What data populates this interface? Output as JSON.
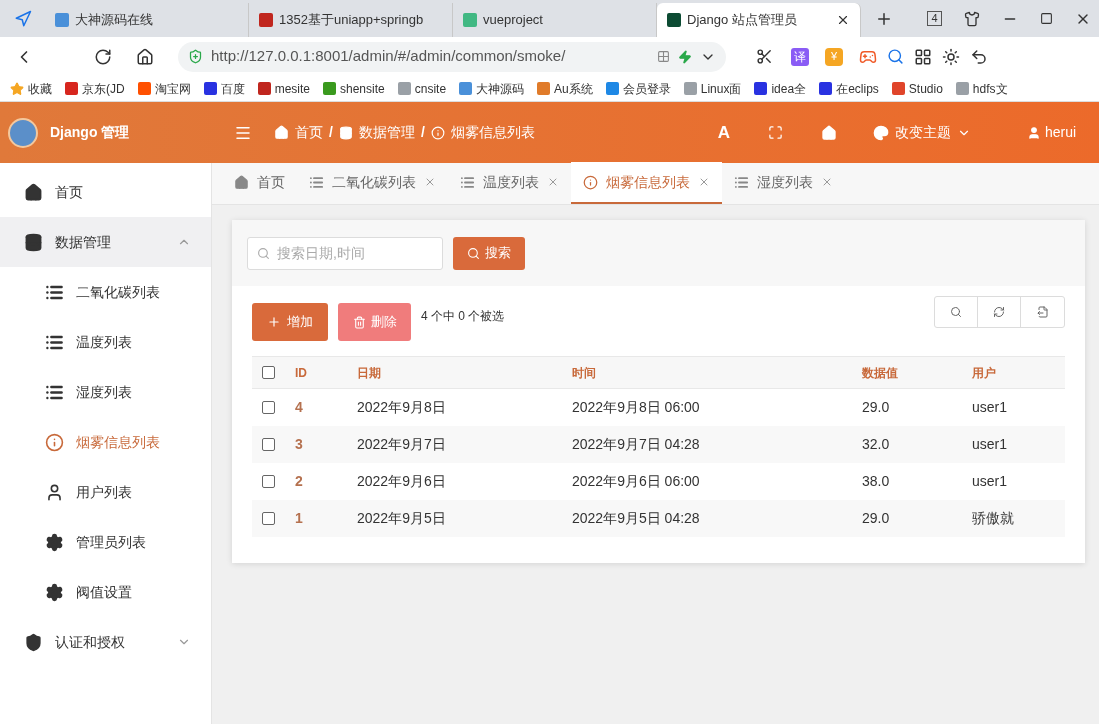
{
  "browser": {
    "tabs": [
      {
        "title": "大神源码在线",
        "selected": false,
        "color": "#4a90d9"
      },
      {
        "title": "1352基于uniapp+springb",
        "selected": false,
        "color": "#c0261e"
      },
      {
        "title": "vueproject",
        "selected": false,
        "color": "#41b883"
      },
      {
        "title": "Django 站点管理员",
        "selected": true,
        "color": "#0c4b33"
      }
    ],
    "tab_count": "4",
    "url": "http://127.0.0.1:8001/admin/#/admin/common/smoke/",
    "translate_label": "译",
    "currency_label": "¥",
    "bookmarks": [
      {
        "label": "收藏",
        "color": "#f5a623"
      },
      {
        "label": "京东(JD",
        "color": "#d7261e"
      },
      {
        "label": "淘宝网",
        "color": "#ff5000"
      },
      {
        "label": "百度",
        "color": "#2932e1"
      },
      {
        "label": "mesite",
        "color": "#c0261e"
      },
      {
        "label": "shensite",
        "color": "#3a9a1e"
      },
      {
        "label": "cnsite",
        "color": "#9aa0a6"
      },
      {
        "label": "大神源码",
        "color": "#4a90d9"
      },
      {
        "label": "Au系统",
        "color": "#e07b2a"
      },
      {
        "label": "会员登录",
        "color": "#1e88e5"
      },
      {
        "label": "Linux面",
        "color": "#9aa0a6"
      },
      {
        "label": "idea全",
        "color": "#2932e1"
      },
      {
        "label": "在eclips",
        "color": "#2932e1"
      },
      {
        "label": "Studio",
        "color": "#e0452a"
      },
      {
        "label": "hdfs文",
        "color": "#9aa0a6"
      }
    ]
  },
  "header": {
    "brand": "Django 管理",
    "breadcrumb": [
      "首页",
      "数据管理",
      "烟雾信息列表"
    ],
    "separator": "/",
    "font_label": "A",
    "theme_label": "改变主题",
    "user": "herui"
  },
  "sidebar": {
    "items": [
      {
        "label": "首页",
        "kind": "home",
        "selected": false
      },
      {
        "label": "数据管理",
        "kind": "database",
        "selected": false,
        "expanded": true,
        "children": [
          {
            "label": "二氧化碳列表",
            "kind": "list",
            "selected": false
          },
          {
            "label": "温度列表",
            "kind": "list",
            "selected": false
          },
          {
            "label": "湿度列表",
            "kind": "list",
            "selected": false
          },
          {
            "label": "烟雾信息列表",
            "kind": "info",
            "selected": true
          },
          {
            "label": "用户列表",
            "kind": "user",
            "selected": false
          },
          {
            "label": "管理员列表",
            "kind": "gear",
            "selected": false
          },
          {
            "label": "阀值设置",
            "kind": "gear",
            "selected": false
          }
        ]
      },
      {
        "label": "认证和授权",
        "kind": "shield",
        "selected": false,
        "expanded": false
      }
    ]
  },
  "page_tabs": [
    {
      "label": "首页",
      "kind": "home",
      "selected": false,
      "closable": false
    },
    {
      "label": "二氧化碳列表",
      "kind": "list",
      "selected": false,
      "closable": true
    },
    {
      "label": "温度列表",
      "kind": "list",
      "selected": false,
      "closable": true
    },
    {
      "label": "烟雾信息列表",
      "kind": "info",
      "selected": true,
      "closable": true
    },
    {
      "label": "湿度列表",
      "kind": "list",
      "selected": false,
      "closable": true
    }
  ],
  "search": {
    "placeholder": "搜索日期,时间",
    "button": "搜索"
  },
  "actions": {
    "add": "增加",
    "delete": "删除",
    "selection": "4 个中 0 个被选"
  },
  "table": {
    "all_checked": false,
    "columns": [
      "ID",
      "日期",
      "时间",
      "数据值",
      "用户"
    ],
    "rows": [
      {
        "checked": false,
        "cells": [
          "4",
          "2022年9月8日",
          "2022年9月8日 06:00",
          "29.0",
          "user1"
        ]
      },
      {
        "checked": false,
        "cells": [
          "3",
          "2022年9月7日",
          "2022年9月7日 04:28",
          "32.0",
          "user1"
        ]
      },
      {
        "checked": false,
        "cells": [
          "2",
          "2022年9月6日",
          "2022年9月6日 06:00",
          "38.0",
          "user1"
        ]
      },
      {
        "checked": false,
        "cells": [
          "1",
          "2022年9月5日",
          "2022年9月5日 04:28",
          "29.0",
          "骄傲就"
        ]
      }
    ]
  }
}
